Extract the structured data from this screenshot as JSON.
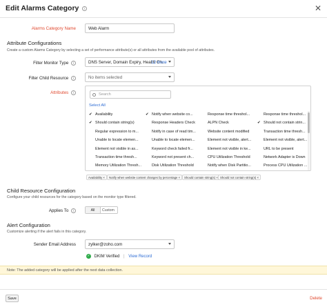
{
  "window": {
    "title": "Edit Alarms Category",
    "close_glyph": "✕"
  },
  "category_name": {
    "label": "Alarms Category Name",
    "value": "Web Alarm"
  },
  "attribute_config": {
    "title": "Attribute Configurations",
    "subtitle": "Create a custom Alarms Category by selecting a set of performance attribute(s) or all attributes from the available pool of attributes.",
    "filter_monitor_type": {
      "label": "Filter Monitor Type",
      "value": "DNS Server, Domain Expiry, Health Ch...",
      "more": "12 more"
    },
    "filter_child_resource": {
      "label": "Filter Child Resource",
      "value": "No items selected"
    },
    "attributes": {
      "label": "Attributes",
      "search_placeholder": "Search",
      "select_all": "Select All",
      "items": [
        {
          "text": "Availability",
          "checked": true
        },
        {
          "text": "Notify when website co...",
          "checked": true
        },
        {
          "text": "Response time threshol...",
          "checked": false
        },
        {
          "text": "Response time threshol...",
          "checked": false
        },
        {
          "text": "Should contain string(s)",
          "checked": true
        },
        {
          "text": "Response Headers Check",
          "checked": false
        },
        {
          "text": "ALPN Check",
          "checked": false
        },
        {
          "text": "Should not contain strin...",
          "checked": true
        },
        {
          "text": "Regular expression to m...",
          "checked": false
        },
        {
          "text": "Notify in case of read tim...",
          "checked": false
        },
        {
          "text": "Website content modified",
          "checked": false
        },
        {
          "text": "Transaction time thresh...",
          "checked": false
        },
        {
          "text": "Unable to locate elemen...",
          "checked": false
        },
        {
          "text": "Unable to locate elemen...",
          "checked": false
        },
        {
          "text": "Element not visible, alert...",
          "checked": false
        },
        {
          "text": "Element not visible, alert...",
          "checked": false
        },
        {
          "text": "Element not visible in as...",
          "checked": false
        },
        {
          "text": "Keyword check failed fr...",
          "checked": false
        },
        {
          "text": "Element not visible in ke...",
          "checked": false
        },
        {
          "text": "URL to be present",
          "checked": false
        },
        {
          "text": "Transaction time thresh...",
          "checked": false
        },
        {
          "text": "Keyword not present ch...",
          "checked": false
        },
        {
          "text": "CPU Utilization Threshold",
          "checked": false
        },
        {
          "text": "Network Adapter is Down",
          "checked": false
        },
        {
          "text": "Memory Utilization Thresh...",
          "checked": false
        },
        {
          "text": "Disk Utilization Threshold",
          "checked": false
        },
        {
          "text": "Notify when Disk Partitio...",
          "checked": false
        },
        {
          "text": "Process CPU Utilization ...",
          "checked": false
        }
      ],
      "chips": [
        "Availability ×",
        "Notify when website content changes by percentage ×",
        "Should contain string(s) ×",
        "Should not contain string(s) ×"
      ]
    }
  },
  "child_resource_config": {
    "title": "Child Resource Configuration",
    "subtitle": "Configure your child resources for the category based on the monitor type filtered.",
    "applies_to": {
      "label": "Applies To",
      "options": [
        "All",
        "Custom"
      ],
      "selected": "All"
    }
  },
  "alert_config": {
    "title": "Alert Configuration",
    "subtitle": "Customize alerting if the alert fails in this category.",
    "sender_email": {
      "label": "Sender Email Address",
      "value": "zylker@zoho.com"
    },
    "dkim": {
      "status": "DKIM Verified",
      "link": "View Record",
      "separator": "|"
    }
  },
  "note": "Note: The added category will be applied after the next data collection.",
  "footer": {
    "save_label": "Save",
    "delete_label": "Delete"
  },
  "colors": {
    "accent_link": "#2b6bd4",
    "required_label": "#e0492f",
    "verified_green": "#2eab4a",
    "note_bg": "#fff7d9"
  },
  "icons": [
    "info-icon",
    "close-icon",
    "search-icon",
    "check-icon",
    "chevron-down-icon",
    "verified-check-icon"
  ]
}
